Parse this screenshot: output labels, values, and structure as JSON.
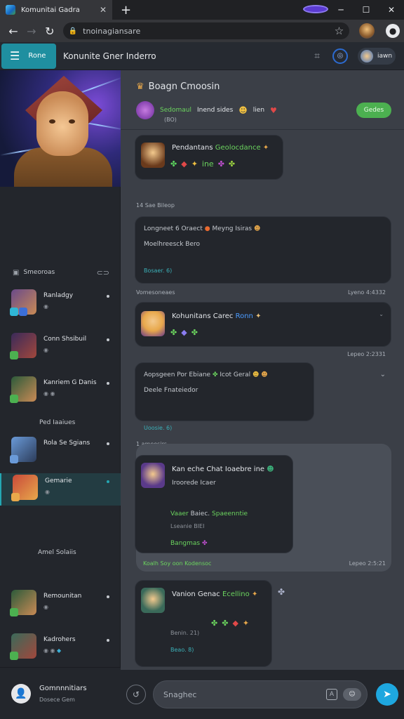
{
  "browser": {
    "tab_title": "Komunitai Gadra",
    "url": "tnoinagiansare"
  },
  "header": {
    "home_label": "Rone",
    "title": "Konunite Gner Inderro",
    "user_name": "iawn"
  },
  "sidebar": {
    "section_title": "Smeoroas",
    "items": [
      {
        "name": "Ranladgy",
        "sub": ""
      },
      {
        "name": "Conn Shsibuil",
        "sub": ""
      },
      {
        "name": "Kanriem G Danis",
        "sub": ""
      },
      {
        "plain": "Ped Iaaiues"
      },
      {
        "name": "Rola Se Sgians",
        "sub": ""
      },
      {
        "name": "Gemarie",
        "sub": ""
      },
      {
        "plain": "Amel Solaiis"
      },
      {
        "name": "Remounitan",
        "sub": ""
      },
      {
        "name": "Kadrohers",
        "sub": ""
      }
    ],
    "footer": {
      "title": "Gomnnnitiars",
      "sub": "Dosece Gem"
    }
  },
  "channel": {
    "title": "Boagn Cmoosin",
    "top_green": "Sedomaul",
    "top_name": "Inend sides",
    "top_after": "lien",
    "top_sub": "(BO)",
    "join_label": "Gedes"
  },
  "messages": {
    "m1_title_a": "Pendantans",
    "m1_title_b": "Geolocdance",
    "m1_tag": "ine",
    "sep1": "14 Sae Bileop",
    "m2_line1": "Longneet 6 Oraect",
    "m2_line1b": "Meyng Isiras",
    "m2_line2": "Moelhreesck Bero",
    "m2_meta": "Bosaer. 6)",
    "sep2_l": "Vomesoneaes",
    "sep2_r": "Lyeno 4:4332",
    "m3_title_a": "Kohunitans Carec",
    "m3_title_b": "Ronn",
    "m3_time": "Lepeo 2:2331",
    "m4_line1": "Aopsgeen Por Ebiane",
    "m4_line1b": "Icot Geral",
    "m4_line2": "Deele Fnateiedor",
    "m4_meta": "Uoosie. 6)",
    "sep3": "1 ameesirs",
    "m5_title": "Kan eche Chat Ioaebre ine",
    "m5_sub": "Iroorede Icaer",
    "m5_green1": "Vaaer",
    "m5_green1b": "Baiec.",
    "m5_green1c": "Spaeenntie",
    "m5_meta": "Lseanie BIEI",
    "m5_green2": "Bangmas",
    "m5_footer_green": "Koalh Soy oon Kodensoc",
    "m5_time": "Lepeo 2:5:21",
    "m6_title_a": "Vanion Genac",
    "m6_title_b": "Ecellino",
    "m6_meta1": "Benin. 21)",
    "m6_meta2": "Beao. 8)"
  },
  "composer": {
    "placeholder": "Snaghec"
  }
}
